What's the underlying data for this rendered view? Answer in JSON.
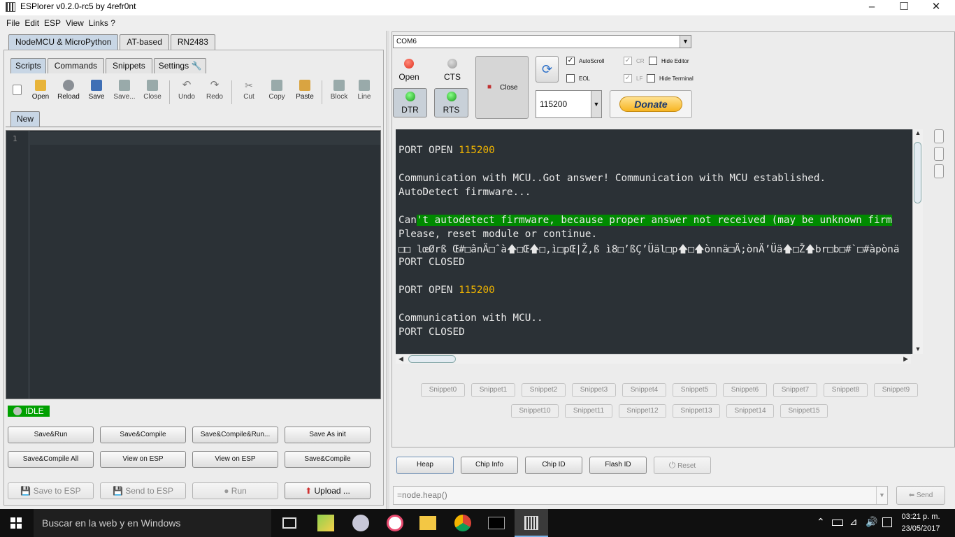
{
  "window": {
    "title": "ESPlorer v0.2.0-rc5 by 4refr0nt"
  },
  "menu": [
    "File",
    "Edit",
    "ESP",
    "View",
    "Links ?"
  ],
  "left": {
    "main_tabs": [
      "NodeMCU & MicroPython",
      "AT-based",
      "RN2483"
    ],
    "sub_tabs": [
      "Scripts",
      "Commands",
      "Snippets",
      "Settings"
    ],
    "toolbar": [
      {
        "label": "",
        "icon": "new-file-icon"
      },
      {
        "label": "Open",
        "icon": "open-folder-icon"
      },
      {
        "label": "Reload",
        "icon": "reload-icon"
      },
      {
        "label": "Save",
        "icon": "save-icon"
      },
      {
        "label": "Save...",
        "icon": "save-as-icon"
      },
      {
        "label": "Close",
        "icon": "close-file-icon"
      },
      {
        "label": "Undo",
        "icon": "undo-icon"
      },
      {
        "label": "Redo",
        "icon": "redo-icon"
      },
      {
        "label": "Cut",
        "icon": "cut-icon"
      },
      {
        "label": "Copy",
        "icon": "copy-icon"
      },
      {
        "label": "Paste",
        "icon": "paste-icon"
      },
      {
        "label": "Block",
        "icon": "block-icon"
      },
      {
        "label": "Line",
        "icon": "line-icon"
      }
    ],
    "file_tab": "New",
    "editor_line": "1",
    "status": "IDLE",
    "buttons_row1": [
      "Save&Run",
      "Save&Compile",
      "Save&Compile&Run...",
      "Save As init"
    ],
    "buttons_row2": [
      "Save&Compile All",
      "View on ESP",
      "View on ESP",
      "Save&Compile"
    ],
    "buttons_row3": [
      "Save to ESP",
      "Send to ESP",
      "Run",
      "Upload ..."
    ]
  },
  "right": {
    "port": "COM6",
    "open_label": "Open",
    "cts_label": "CTS",
    "dtr_label": "DTR",
    "rts_label": "RTS",
    "close_label": "Close",
    "baud": "115200",
    "donate": "Donate",
    "checks": {
      "autoscroll": "AutoScroll",
      "eol": "EOL",
      "cr": "CR",
      "lf": "LF",
      "hide_editor": "Hide Editor",
      "hide_terminal": "Hide Terminal"
    },
    "terminal": {
      "port_open_1": "PORT OPEN ",
      "baud_1": "115200",
      "comm_1": "Communication with MCU..Got answer! Communication with MCU established.",
      "autodetect": "AutoDetect firmware...",
      "cant_pre": "Can",
      "cant_hl": "'t autodetect firmware, because proper answer not received (may be unknown firm",
      "reset": "Please, reset module or continue.",
      "garbage": "□□ lœØrß Œ#□ânÄ□ˆà🡅□Œ🡅□,ì□pŒ|Ž,ß ì8□’ßÇ’Üäl□p🡅□🡅ònnä□Ä;ònÄ’Üä🡅□Ž🡅br□b□#`□#àpònä",
      "closed_1": "PORT CLOSED",
      "port_open_2": "PORT OPEN ",
      "baud_2": "115200",
      "comm_2": "Communication with MCU..",
      "closed_2": "PORT CLOSED"
    },
    "snippets_row1": [
      "Snippet0",
      "Snippet1",
      "Snippet2",
      "Snippet3",
      "Snippet4",
      "Snippet5",
      "Snippet6",
      "Snippet7",
      "Snippet8",
      "Snippet9"
    ],
    "snippets_row2": [
      "Snippet10",
      "Snippet11",
      "Snippet12",
      "Snippet13",
      "Snippet14",
      "Snippet15"
    ],
    "cmd_buttons": [
      "Heap",
      "Chip Info",
      "Chip ID",
      "Flash ID",
      "Reset"
    ],
    "command_input": "=node.heap()",
    "send": "Send"
  },
  "taskbar": {
    "search_placeholder": "Buscar en la web y en Windows",
    "time": "03:21 p. m.",
    "date": "23/05/2017"
  },
  "colors": {
    "accent": "#c8d6e5",
    "terminal_bg": "#2b3136",
    "highlight": "#008a00",
    "number": "#f0b400",
    "idle": "#00a000"
  }
}
